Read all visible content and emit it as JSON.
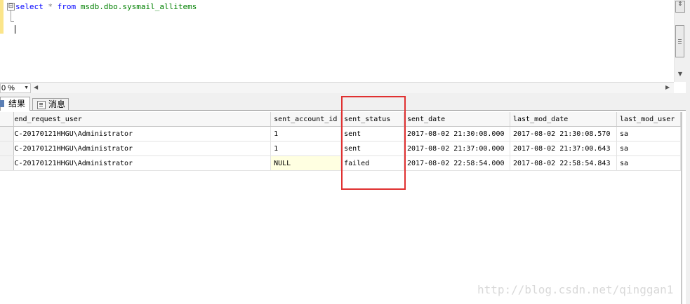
{
  "editor": {
    "collapse_symbol": "⊟",
    "query": {
      "select_kw": "select",
      "star": "*",
      "from_kw": "from",
      "db": "msdb.dbo.",
      "table": "sysmail_allitems"
    }
  },
  "zoom": {
    "value": "0 %",
    "dropdown_arrow": "▼"
  },
  "scroll_icons": {
    "split": "⇕",
    "down": "▼",
    "left": "◀",
    "right": "▶"
  },
  "tabs": [
    {
      "label": "结果"
    },
    {
      "label": "消息"
    }
  ],
  "results": {
    "columns": [
      "end_request_user",
      "sent_account_id",
      "sent_status",
      "sent_date",
      "last_mod_date",
      "last_mod_user"
    ],
    "rows": [
      [
        "C-20170121HHGU\\Administrator",
        "1",
        "sent",
        "2017-08-02 21:30:08.000",
        "2017-08-02 21:30:08.570",
        "sa"
      ],
      [
        "C-20170121HHGU\\Administrator",
        "1",
        "sent",
        "2017-08-02 21:37:00.000",
        "2017-08-02 21:37:00.643",
        "sa"
      ],
      [
        "C-20170121HHGU\\Administrator",
        "NULL",
        "failed",
        "2017-08-02 22:58:54.000",
        "2017-08-02 22:58:54.843",
        "sa"
      ]
    ]
  },
  "watermark": "http://blog.csdn.net/qinggan1",
  "colors": {
    "keyword": "#0000ff",
    "operator": "#808080",
    "object": "#008000",
    "highlight_box": "#e03131",
    "null_cell": "#ffffe1"
  }
}
